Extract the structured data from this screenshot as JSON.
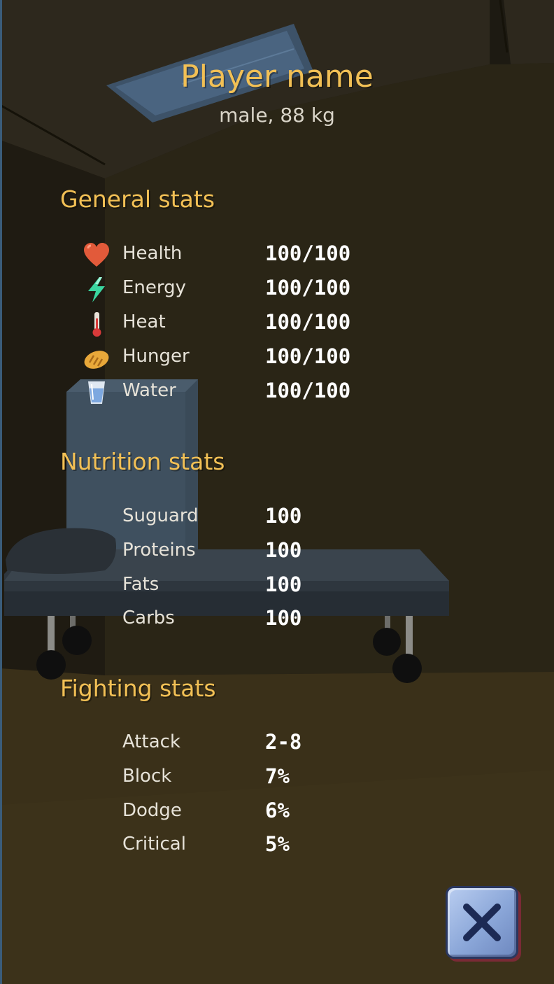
{
  "player": {
    "name": "Player name",
    "info": "male, 88 kg"
  },
  "sections": {
    "general": {
      "title": "General stats",
      "items": [
        {
          "icon": "heart-icon",
          "label": "Health",
          "value": "100/100"
        },
        {
          "icon": "lightning-icon",
          "label": "Energy",
          "value": "100/100"
        },
        {
          "icon": "thermometer-icon",
          "label": "Heat",
          "value": "100/100"
        },
        {
          "icon": "bread-icon",
          "label": "Hunger",
          "value": "100/100"
        },
        {
          "icon": "water-glass-icon",
          "label": "Water",
          "value": "100/100"
        }
      ]
    },
    "nutrition": {
      "title": "Nutrition stats",
      "items": [
        {
          "label": "Suguard",
          "value": "100"
        },
        {
          "label": "Proteins",
          "value": "100"
        },
        {
          "label": "Fats",
          "value": "100"
        },
        {
          "label": "Carbs",
          "value": "100"
        }
      ]
    },
    "fighting": {
      "title": "Fighting stats",
      "items": [
        {
          "label": "Attack",
          "value": "2-8"
        },
        {
          "label": "Block",
          "value": "7%"
        },
        {
          "label": "Dodge",
          "value": "6%"
        },
        {
          "label": "Critical",
          "value": "5%"
        }
      ]
    }
  },
  "close_button": {
    "icon": "close-x-icon"
  },
  "colors": {
    "accent": "#f2c055",
    "text": "#e6e2d8",
    "value": "#ffffff",
    "button": "#8aa6d8"
  }
}
